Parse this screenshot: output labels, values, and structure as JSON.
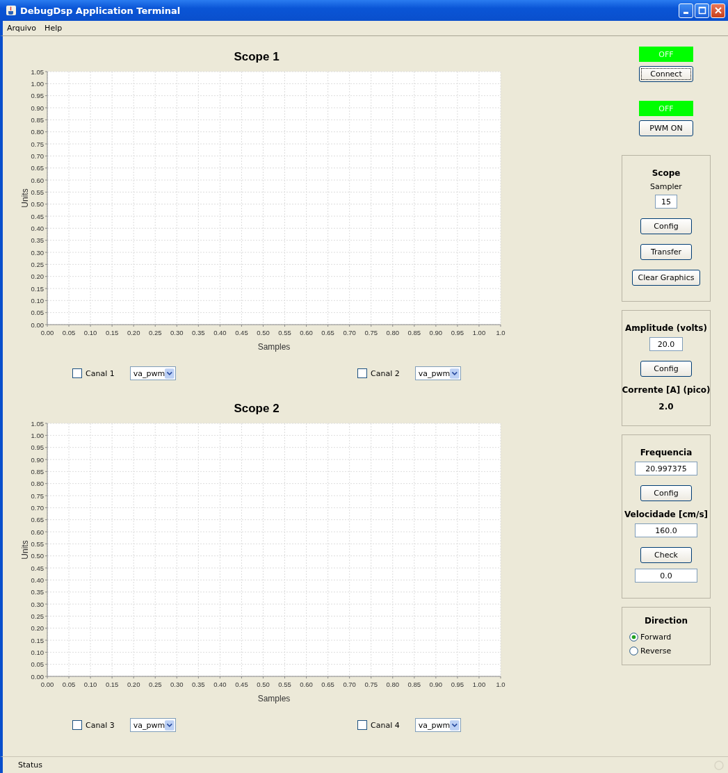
{
  "window": {
    "title": "DebugDsp Application Terminal"
  },
  "menu": [
    "Arquivo",
    "Help"
  ],
  "scopes": [
    {
      "chart_data": {
        "type": "line",
        "title": "Scope 1",
        "xlabel": "Samples",
        "ylabel": "Units",
        "grid": true,
        "xlim": [
          0,
          1.05
        ],
        "ylim": [
          0,
          1.05
        ],
        "xticks": [
          {
            "value": 0,
            "label": "0.00"
          },
          {
            "value": 0.05,
            "label": "0.05"
          },
          {
            "value": 0.1,
            "label": "0.10"
          },
          {
            "value": 0.15,
            "label": "0.15"
          },
          {
            "value": 0.2,
            "label": "0.20"
          },
          {
            "value": 0.25,
            "label": "0.25"
          },
          {
            "value": 0.3,
            "label": "0.30"
          },
          {
            "value": 0.35,
            "label": "0.35"
          },
          {
            "value": 0.4,
            "label": "0.40"
          },
          {
            "value": 0.45,
            "label": "0.45"
          },
          {
            "value": 0.5,
            "label": "0.50"
          },
          {
            "value": 0.55,
            "label": "0.55"
          },
          {
            "value": 0.6,
            "label": "0.60"
          },
          {
            "value": 0.65,
            "label": "0.65"
          },
          {
            "value": 0.7,
            "label": "0.70"
          },
          {
            "value": 0.75,
            "label": "0.75"
          },
          {
            "value": 0.8,
            "label": "0.80"
          },
          {
            "value": 0.85,
            "label": "0.85"
          },
          {
            "value": 0.9,
            "label": "0.90"
          },
          {
            "value": 0.95,
            "label": "0.95"
          },
          {
            "value": 1,
            "label": "1.00"
          },
          {
            "value": 1.05,
            "label": "1.0"
          }
        ],
        "yticks": [
          {
            "value": 0,
            "label": "0.00"
          },
          {
            "value": 0.05,
            "label": "0.05"
          },
          {
            "value": 0.1,
            "label": "0.10"
          },
          {
            "value": 0.15,
            "label": "0.15"
          },
          {
            "value": 0.2,
            "label": "0.20"
          },
          {
            "value": 0.25,
            "label": "0.25"
          },
          {
            "value": 0.3,
            "label": "0.30"
          },
          {
            "value": 0.35,
            "label": "0.35"
          },
          {
            "value": 0.4,
            "label": "0.40"
          },
          {
            "value": 0.45,
            "label": "0.45"
          },
          {
            "value": 0.5,
            "label": "0.50"
          },
          {
            "value": 0.55,
            "label": "0.55"
          },
          {
            "value": 0.6,
            "label": "0.60"
          },
          {
            "value": 0.65,
            "label": "0.65"
          },
          {
            "value": 0.7,
            "label": "0.70"
          },
          {
            "value": 0.75,
            "label": "0.75"
          },
          {
            "value": 0.8,
            "label": "0.80"
          },
          {
            "value": 0.85,
            "label": "0.85"
          },
          {
            "value": 0.9,
            "label": "0.90"
          },
          {
            "value": 0.95,
            "label": "0.95"
          },
          {
            "value": 1,
            "label": "1.00"
          },
          {
            "value": 1.05,
            "label": "1.05"
          }
        ]
      },
      "channels": [
        {
          "label": "Canal 1",
          "checked": false,
          "signal": "va_pwm"
        },
        {
          "label": "Canal 2",
          "checked": false,
          "signal": "va_pwm"
        }
      ]
    },
    {
      "chart_data": {
        "type": "line",
        "title": "Scope 2",
        "xlabel": "Samples",
        "ylabel": "Units",
        "grid": true,
        "xlim": [
          0,
          1.05
        ],
        "ylim": [
          0,
          1.05
        ],
        "xticks": [
          {
            "value": 0,
            "label": "0.00"
          },
          {
            "value": 0.05,
            "label": "0.05"
          },
          {
            "value": 0.1,
            "label": "0.10"
          },
          {
            "value": 0.15,
            "label": "0.15"
          },
          {
            "value": 0.2,
            "label": "0.20"
          },
          {
            "value": 0.25,
            "label": "0.25"
          },
          {
            "value": 0.3,
            "label": "0.30"
          },
          {
            "value": 0.35,
            "label": "0.35"
          },
          {
            "value": 0.4,
            "label": "0.40"
          },
          {
            "value": 0.45,
            "label": "0.45"
          },
          {
            "value": 0.5,
            "label": "0.50"
          },
          {
            "value": 0.55,
            "label": "0.55"
          },
          {
            "value": 0.6,
            "label": "0.60"
          },
          {
            "value": 0.65,
            "label": "0.65"
          },
          {
            "value": 0.7,
            "label": "0.70"
          },
          {
            "value": 0.75,
            "label": "0.75"
          },
          {
            "value": 0.8,
            "label": "0.80"
          },
          {
            "value": 0.85,
            "label": "0.85"
          },
          {
            "value": 0.9,
            "label": "0.90"
          },
          {
            "value": 0.95,
            "label": "0.95"
          },
          {
            "value": 1,
            "label": "1.00"
          },
          {
            "value": 1.05,
            "label": "1.0"
          }
        ],
        "yticks": [
          {
            "value": 0,
            "label": "0.00"
          },
          {
            "value": 0.05,
            "label": "0.05"
          },
          {
            "value": 0.1,
            "label": "0.10"
          },
          {
            "value": 0.15,
            "label": "0.15"
          },
          {
            "value": 0.2,
            "label": "0.20"
          },
          {
            "value": 0.25,
            "label": "0.25"
          },
          {
            "value": 0.3,
            "label": "0.30"
          },
          {
            "value": 0.35,
            "label": "0.35"
          },
          {
            "value": 0.4,
            "label": "0.40"
          },
          {
            "value": 0.45,
            "label": "0.45"
          },
          {
            "value": 0.5,
            "label": "0.50"
          },
          {
            "value": 0.55,
            "label": "0.55"
          },
          {
            "value": 0.6,
            "label": "0.60"
          },
          {
            "value": 0.65,
            "label": "0.65"
          },
          {
            "value": 0.7,
            "label": "0.70"
          },
          {
            "value": 0.75,
            "label": "0.75"
          },
          {
            "value": 0.8,
            "label": "0.80"
          },
          {
            "value": 0.85,
            "label": "0.85"
          },
          {
            "value": 0.9,
            "label": "0.90"
          },
          {
            "value": 0.95,
            "label": "0.95"
          },
          {
            "value": 1,
            "label": "1.00"
          },
          {
            "value": 1.05,
            "label": "1.05"
          }
        ]
      },
      "channels": [
        {
          "label": "Canal 3",
          "checked": false,
          "signal": "va_pwm"
        },
        {
          "label": "Canal 4",
          "checked": false,
          "signal": "va_pwm"
        }
      ]
    }
  ],
  "switches": [
    {
      "indicator": "OFF",
      "button": "Connect"
    },
    {
      "indicator": "OFF",
      "button": "PWM ON"
    }
  ],
  "groups": [
    {
      "items": [
        {
          "kind": "heading",
          "text": "Scope"
        },
        {
          "kind": "label",
          "text": "Sampler"
        },
        {
          "kind": "field",
          "value": "15"
        },
        {
          "kind": "button",
          "text": "Config"
        },
        {
          "kind": "button",
          "text": "Transfer"
        },
        {
          "kind": "button",
          "text": "Clear Graphics"
        }
      ]
    },
    {
      "items": [
        {
          "kind": "heading",
          "text": "Amplitude (volts)"
        },
        {
          "kind": "field",
          "value": "20.0"
        },
        {
          "kind": "button",
          "text": "Config"
        },
        {
          "kind": "heading",
          "text": "Corrente [A] (pico)"
        },
        {
          "kind": "heading",
          "text": "2.0"
        }
      ]
    },
    {
      "items": [
        {
          "kind": "heading",
          "text": "Frequencia"
        },
        {
          "kind": "field",
          "value": "20.997375"
        },
        {
          "kind": "button",
          "text": "Config"
        },
        {
          "kind": "heading",
          "text": "Velocidade [cm/s]"
        },
        {
          "kind": "field",
          "value": "160.0"
        },
        {
          "kind": "button",
          "text": "Check"
        },
        {
          "kind": "field",
          "value": "0.0"
        }
      ]
    }
  ],
  "direction": {
    "title": "Direction",
    "options": [
      {
        "label": "Forward",
        "selected": true
      },
      {
        "label": "Reverse",
        "selected": false
      }
    ]
  },
  "status_bar": {
    "text": "Status"
  }
}
